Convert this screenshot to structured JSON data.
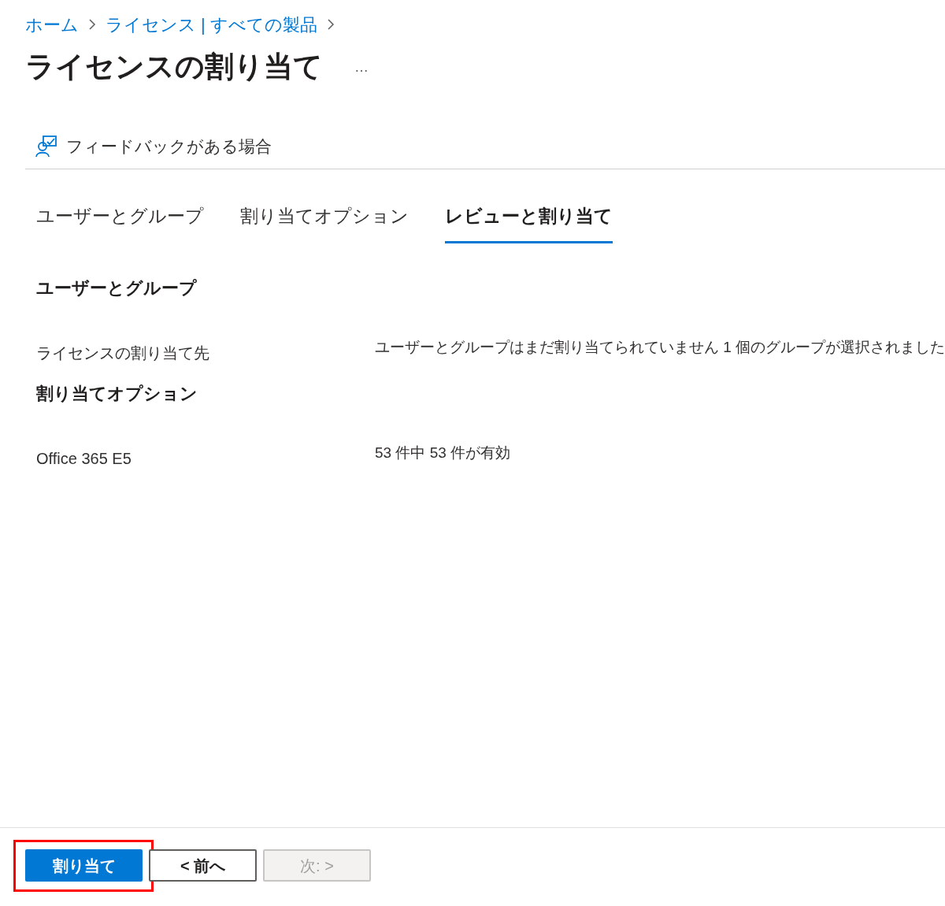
{
  "breadcrumb": [
    "ホーム",
    "ライセンス | すべての製品"
  ],
  "title": "ライセンスの割り当て",
  "more": "…",
  "feedback": "フィードバックがある場合",
  "tabs": [
    {
      "label": "ユーザーとグループ",
      "selected": false
    },
    {
      "label": "割り当てオプション",
      "selected": false
    },
    {
      "label": "レビューと割り当て",
      "selected": true
    }
  ],
  "sections": [
    {
      "heading": "ユーザーとグループ",
      "rows": [
        {
          "label": "ライセンスの割り当て先",
          "value": "ユーザーとグループはまだ割り当てられていません 1 個のグループが選択されました"
        }
      ]
    },
    {
      "heading": "割り当てオプション",
      "rows": [
        {
          "label": "Office 365 E5",
          "value": "53 件中 53 件が有効"
        }
      ]
    }
  ],
  "buttons": [
    {
      "label": "割り当て",
      "kind": "primary",
      "disabled": false,
      "highlighted": true
    },
    {
      "label": "< 前へ",
      "kind": "secondary",
      "disabled": false,
      "highlighted": false
    },
    {
      "label": "次: >",
      "kind": "secondary",
      "disabled": true,
      "highlighted": false
    }
  ]
}
